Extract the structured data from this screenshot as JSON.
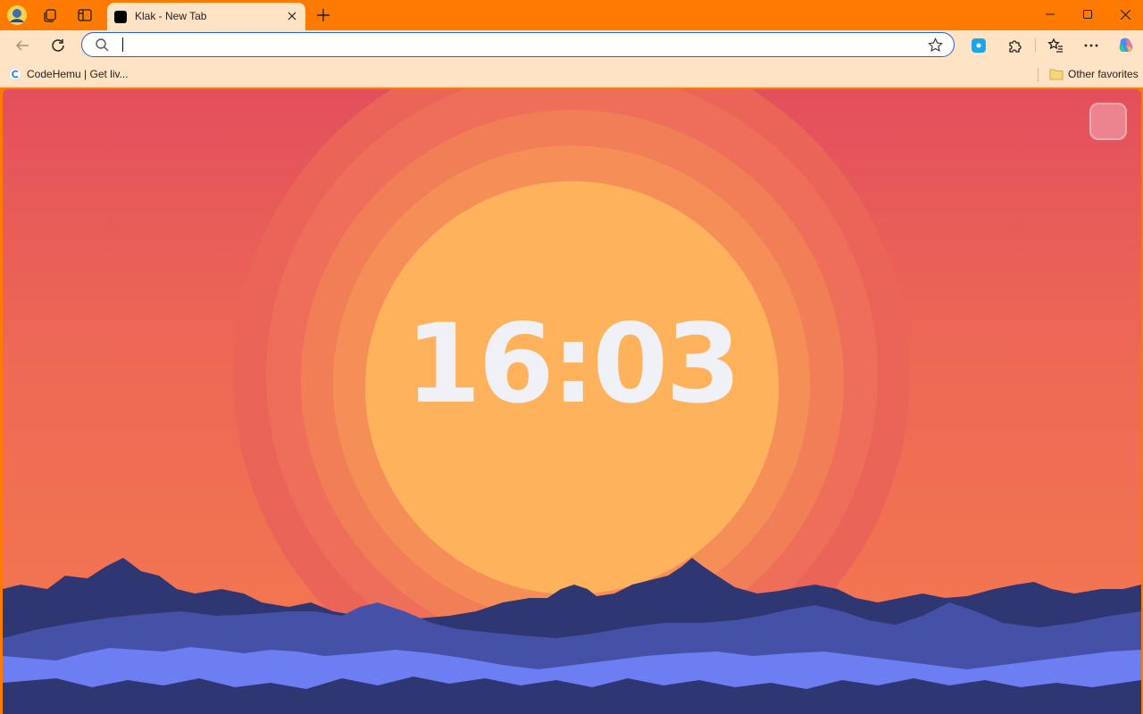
{
  "browser": {
    "tab": {
      "title": "Klak - New Tab"
    },
    "address_bar": {
      "value": "",
      "placeholder": ""
    },
    "favorites": [
      {
        "label": "CodeHemu | Get liv..."
      }
    ],
    "other_favorites_label": "Other favorites"
  },
  "page": {
    "clock": "16:03"
  },
  "colors": {
    "titlebar": "#ff7a00",
    "toolbar": "#ffe3c4",
    "sky_top": "#e34f5c",
    "sky_bottom": "#f4794f",
    "sun": "#ffb25c",
    "mountain_dark": "#2f3772",
    "mountain_mid": "#4451a6",
    "water": "#6d7ef2"
  }
}
